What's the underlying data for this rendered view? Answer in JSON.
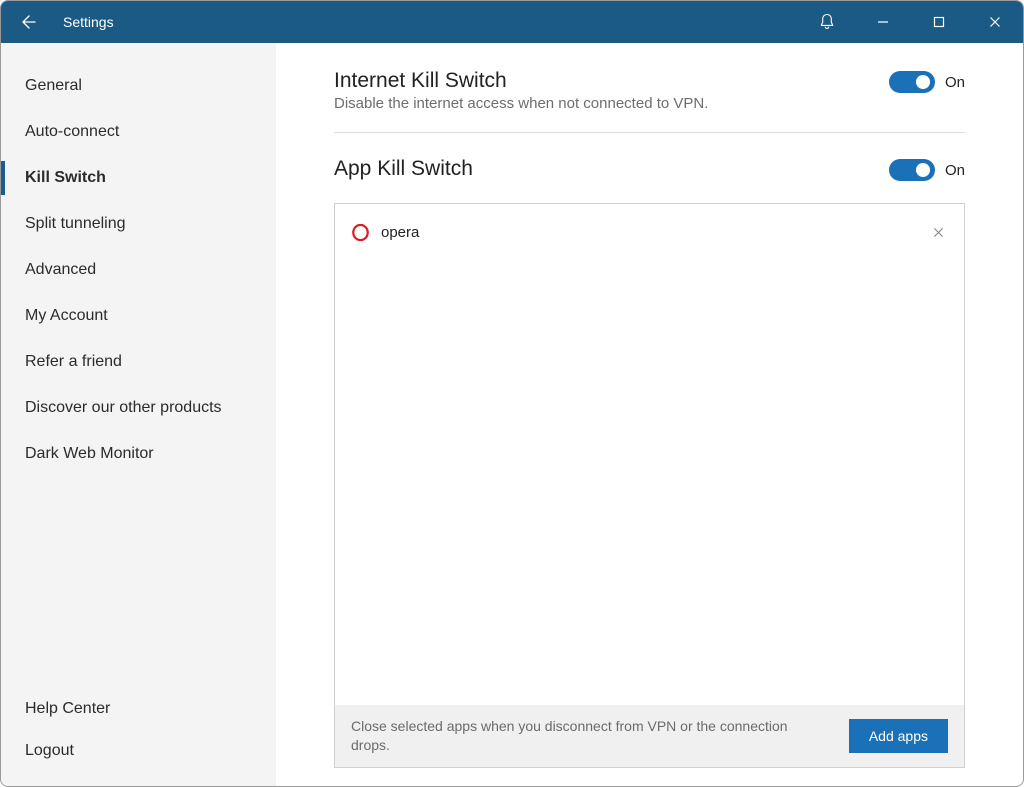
{
  "window": {
    "title": "Settings"
  },
  "sidebar": {
    "items": [
      {
        "label": "General"
      },
      {
        "label": "Auto-connect"
      },
      {
        "label": "Kill Switch"
      },
      {
        "label": "Split tunneling"
      },
      {
        "label": "Advanced"
      },
      {
        "label": "My Account"
      },
      {
        "label": "Refer a friend"
      },
      {
        "label": "Discover our other products"
      },
      {
        "label": "Dark Web Monitor"
      }
    ],
    "active_index": 2,
    "bottom": [
      {
        "label": "Help Center"
      },
      {
        "label": "Logout"
      }
    ]
  },
  "settings": {
    "internet_kill_switch": {
      "title": "Internet Kill Switch",
      "description": "Disable the internet access when not connected to VPN.",
      "state_label": "On",
      "on": true
    },
    "app_kill_switch": {
      "title": "App Kill Switch",
      "state_label": "On",
      "on": true,
      "apps": [
        {
          "name": "opera",
          "icon": "opera-icon"
        }
      ],
      "footer_text": "Close selected apps when you disconnect from VPN or the connection drops.",
      "add_button_label": "Add apps"
    }
  },
  "colors": {
    "titlebar": "#1a5a85",
    "accent": "#1a71b8",
    "sidebar_bg": "#f4f4f4"
  }
}
